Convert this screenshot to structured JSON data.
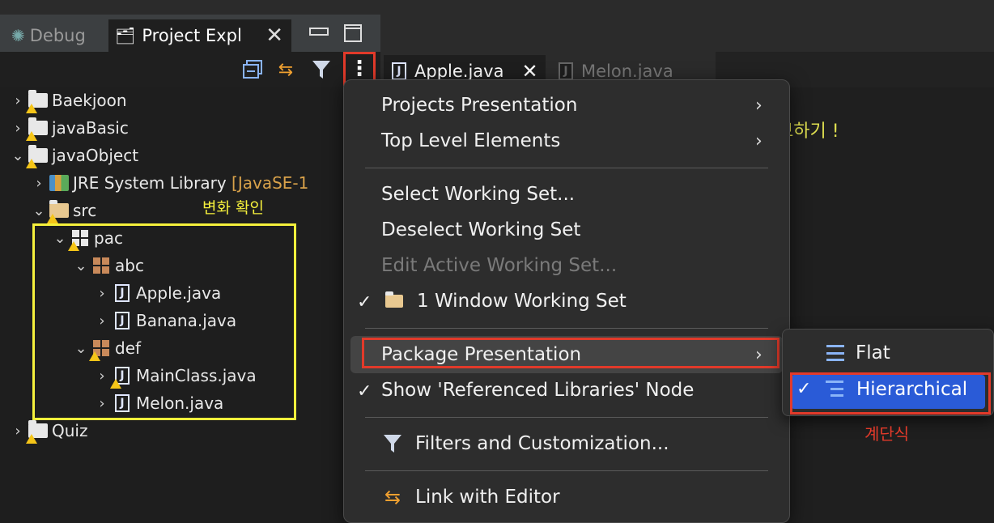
{
  "view_tabs": {
    "debug_label": "Debug",
    "project_label": "Project Expl",
    "close_glyph": "✕"
  },
  "toolbar": {
    "menu_glyph": "⋮",
    "link_glyph": "⇆"
  },
  "editor_tabs": [
    {
      "label": "Apple.java",
      "active": true,
      "close_glyph": "✕"
    },
    {
      "label": "Melon.java",
      "active": false
    }
  ],
  "editor": {
    "visible_text": "보하기 !"
  },
  "tree": [
    {
      "label": "Baekjoon",
      "chev": "›"
    },
    {
      "label": "javaBasic",
      "chev": "›"
    },
    {
      "label": "javaObject",
      "chev": "⌄"
    },
    {
      "label": "JRE System Library",
      "suffix": "[JavaSE-1",
      "chev": "›"
    },
    {
      "label": "src",
      "chev": "⌄"
    },
    {
      "label": "pac",
      "chev": "⌄"
    },
    {
      "label": "abc",
      "chev": "⌄"
    },
    {
      "label": "Apple.java",
      "chev": "›"
    },
    {
      "label": "Banana.java",
      "chev": "›"
    },
    {
      "label": "def",
      "chev": "⌄"
    },
    {
      "label": "MainClass.java",
      "chev": "›"
    },
    {
      "label": "Melon.java",
      "chev": "›"
    },
    {
      "label": "Quiz",
      "chev": "›"
    }
  ],
  "annotations": {
    "yellow": "변화 확인",
    "red": "계단식"
  },
  "menu": {
    "items": [
      {
        "label": "Projects Presentation",
        "arrow": "›"
      },
      {
        "label": "Top Level Elements",
        "arrow": "›"
      },
      {
        "label": "Select Working Set..."
      },
      {
        "label": "Deselect Working Set"
      },
      {
        "label": "Edit Active Working Set...",
        "disabled": true
      },
      {
        "label": "1 Window Working Set",
        "checked": true
      },
      {
        "label": "Package Presentation",
        "arrow": "›"
      },
      {
        "label": "Show 'Referenced Libraries' Node",
        "checked": true
      },
      {
        "label": "Filters and Customization..."
      },
      {
        "label": "Link with Editor"
      }
    ],
    "check_glyph": "✓"
  },
  "submenu": {
    "items": [
      {
        "label": "Flat",
        "checked": false
      },
      {
        "label": "Hierarchical",
        "checked": true
      }
    ]
  },
  "colors": {
    "highlight_yellow": "#f5f03c",
    "highlight_red": "#e23a2a",
    "selection_blue": "#2a5bd7"
  }
}
